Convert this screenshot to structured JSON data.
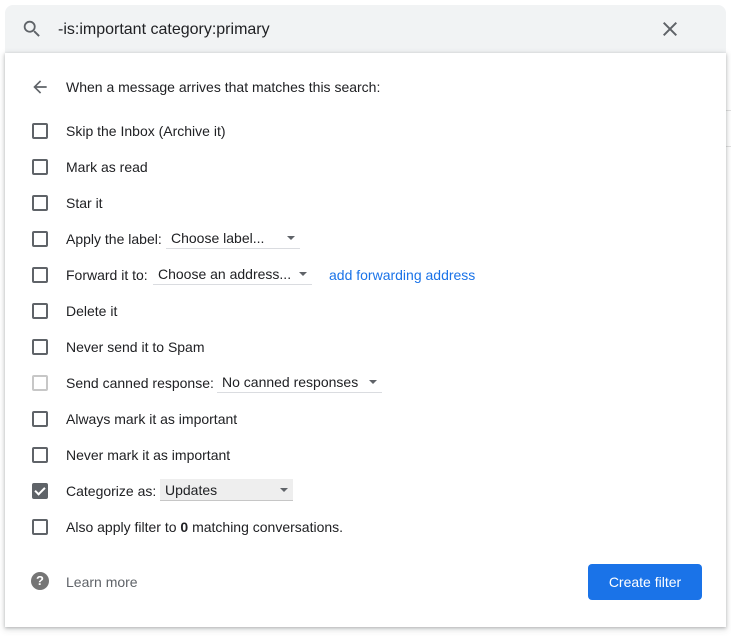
{
  "search": {
    "query": "-is:important category:primary"
  },
  "header": {
    "text": "When a message arrives that matches this search:"
  },
  "options": {
    "skip_inbox": {
      "label": "Skip the Inbox (Archive it)",
      "checked": false
    },
    "mark_read": {
      "label": "Mark as read",
      "checked": false
    },
    "star": {
      "label": "Star it",
      "checked": false
    },
    "apply_label": {
      "label": "Apply the label:",
      "select": "Choose label...",
      "checked": false
    },
    "forward": {
      "label": "Forward it to:",
      "select": "Choose an address...",
      "link": "add forwarding address",
      "checked": false
    },
    "delete": {
      "label": "Delete it",
      "checked": false
    },
    "never_spam": {
      "label": "Never send it to Spam",
      "checked": false
    },
    "canned": {
      "label": "Send canned response:",
      "select": "No canned responses",
      "checked": false
    },
    "always_important": {
      "label": "Always mark it as important",
      "checked": false
    },
    "never_important": {
      "label": "Never mark it as important",
      "checked": false
    },
    "categorize": {
      "label": "Categorize as:",
      "select": "Updates",
      "checked": true
    },
    "also_apply": {
      "label_prefix": "Also apply filter to ",
      "count": "0",
      "label_suffix": " matching conversations.",
      "checked": false
    }
  },
  "footer": {
    "help_glyph": "?",
    "learn_more": "Learn more",
    "create_filter": "Create filter"
  },
  "colors": {
    "accent": "#1a73e8",
    "search_bg": "#f1f3f4",
    "checkbox": "#5f6368"
  },
  "icons": {
    "search": "search-icon",
    "close": "close-icon",
    "back": "arrow-back-icon",
    "help": "help-icon"
  }
}
